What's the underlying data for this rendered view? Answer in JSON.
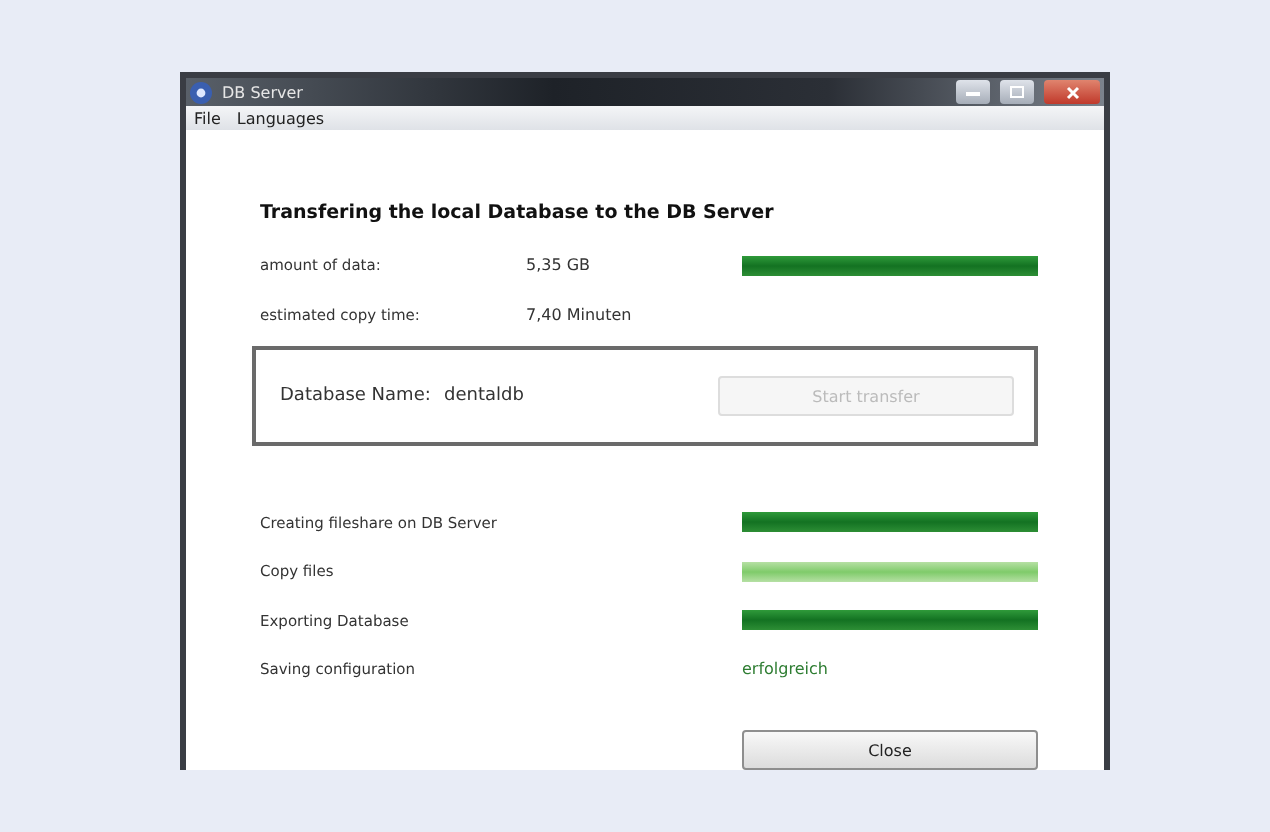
{
  "window": {
    "title": "DB Server"
  },
  "menu": [
    "File",
    "Languages"
  ],
  "heading": "Transfering the local Database to the DB Server",
  "info": [
    {
      "label": "amount of data:",
      "value": "5,35 GB",
      "level": 1
    },
    {
      "label": "estimated copy time:",
      "value": "7,40 Minuten"
    }
  ],
  "database": {
    "label": "Database Name:",
    "value": "dentaldb",
    "button": {
      "label": "Start transfer",
      "disabled": true
    }
  },
  "steps": [
    {
      "label": "Creating fileshare on DB Server",
      "kind": "bar",
      "level": 1,
      "active": false
    },
    {
      "label": "Copy files",
      "kind": "bar",
      "level": 1,
      "active": true
    },
    {
      "label": "Exporting Database",
      "kind": "bar",
      "level": 1,
      "active": false
    },
    {
      "label": "Saving configuration",
      "kind": "text",
      "result": "erfolgreich"
    }
  ],
  "close_button": "Close"
}
